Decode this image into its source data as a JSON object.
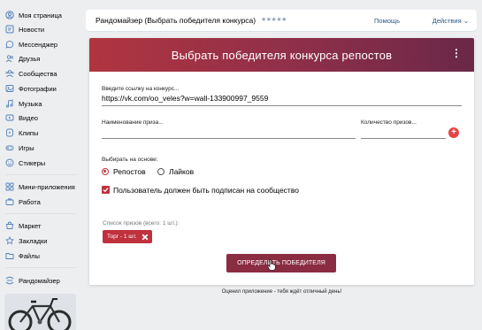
{
  "sidebar": {
    "items": [
      {
        "label": "Моя страница",
        "icon": "user-icon"
      },
      {
        "label": "Новости",
        "icon": "news-icon"
      },
      {
        "label": "Мессенджер",
        "icon": "message-icon"
      },
      {
        "label": "Друзья",
        "icon": "friends-icon"
      },
      {
        "label": "Сообщества",
        "icon": "communities-icon"
      },
      {
        "label": "Фотографии",
        "icon": "photo-icon"
      },
      {
        "label": "Музыка",
        "icon": "music-icon"
      },
      {
        "label": "Видео",
        "icon": "video-icon"
      },
      {
        "label": "Клипы",
        "icon": "clips-icon"
      },
      {
        "label": "Игры",
        "icon": "games-icon"
      },
      {
        "label": "Стикеры",
        "icon": "stickers-icon"
      },
      {
        "label": "Мини-приложения",
        "icon": "apps-icon"
      },
      {
        "label": "Работа",
        "icon": "work-icon"
      },
      {
        "label": "Маркет",
        "icon": "market-icon"
      },
      {
        "label": "Закладки",
        "icon": "bookmark-icon"
      },
      {
        "label": "Файлы",
        "icon": "files-icon"
      },
      {
        "label": "Рандомайзер",
        "icon": "randomizer-icon"
      }
    ]
  },
  "header": {
    "title": "Рандомайзер (Выбрать победителя конкурса)",
    "rating": "★★★★★",
    "help": "Помощь",
    "actions": "Действия ⌄"
  },
  "banner": {
    "title": "Выбрать победителя конкурса репостов",
    "menu_icon": "more-vertical-icon"
  },
  "form": {
    "link_label": "Введите ссылку на конкурс...",
    "link_value": "https://vk.com/oo_veles?w=wall-133900997_9559",
    "prize_label": "Наименование приза...",
    "count_label": "Количество призов...",
    "add_button": "+",
    "basis_label": "Выбирать на основе:",
    "option_reposts": "Репостов",
    "option_likes": "Лайков",
    "selected_option": "Репостов",
    "subscribe_label": "Пользователь должен быть подписан на сообщество",
    "subscribe_checked": true,
    "prize_list_label": "Список призов (всего: 1 шт.):",
    "prize_chip": "Торг - 1 шт.",
    "submit": "ОПРЕДЕЛИТЬ ПОБЕДИТЕЛЯ"
  },
  "footer": {
    "text": "Оценил приложение - тебя ждёт отличный день!"
  },
  "colors": {
    "accent": "#c0313e",
    "button": "#8a2c42",
    "link": "#2a5885"
  }
}
